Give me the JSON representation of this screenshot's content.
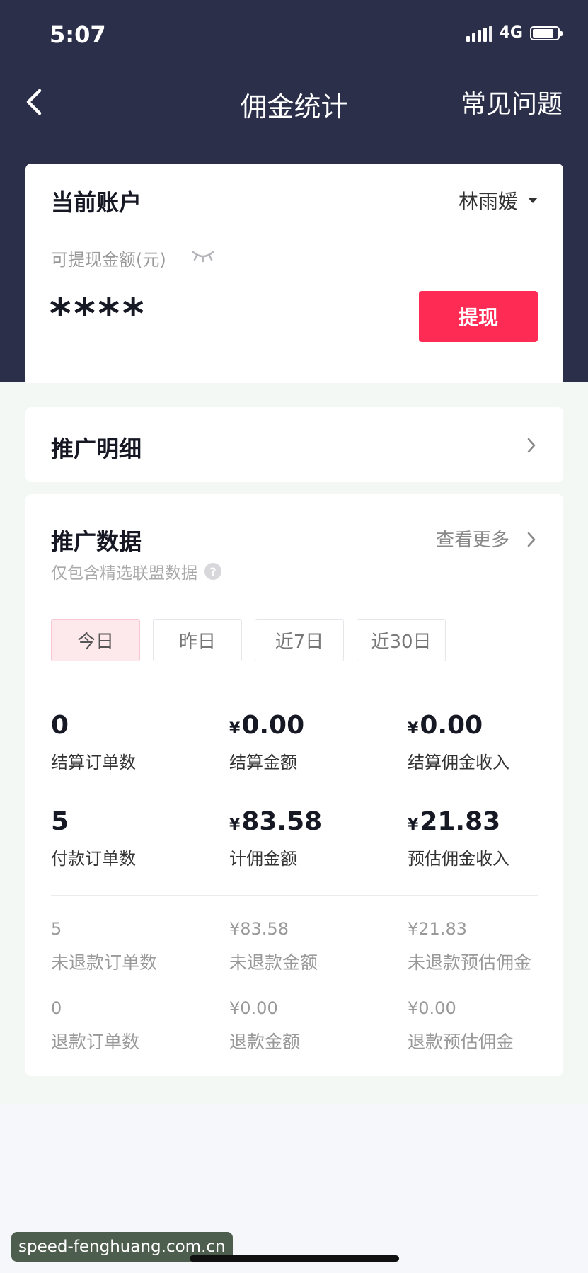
{
  "status_bar": {
    "time": "5:07",
    "network": "4G",
    "battery_level": 0.85,
    "signal_bars": 4
  },
  "nav": {
    "back_icon": "chevron-left-icon",
    "title": "佣金统计",
    "faq": "常见问题"
  },
  "account": {
    "title": "当前账户",
    "user": "林雨媛",
    "available_label": "可提现金额(元)",
    "amount_masked": "****",
    "withdraw_button": "提现"
  },
  "promo_detail": {
    "label": "推广明细"
  },
  "promo_data": {
    "title": "推广数据",
    "more": "查看更多",
    "subtitle": "仅包含精选联盟数据",
    "help_icon": "?",
    "tabs": [
      {
        "label": "今日",
        "active": true
      },
      {
        "label": "昨日",
        "active": false
      },
      {
        "label": "近7日",
        "active": false
      },
      {
        "label": "近30日",
        "active": false
      }
    ],
    "currency": "¥",
    "primary_stats": [
      {
        "value": "0",
        "label": "结算订单数"
      },
      {
        "value": "0.00",
        "label": "结算金额"
      },
      {
        "value": "0.00",
        "label": "结算佣金收入"
      },
      {
        "value": "5",
        "label": "付款订单数"
      },
      {
        "value": "83.58",
        "label": "计佣金额"
      },
      {
        "value": "21.83",
        "label": "预估佣金收入"
      }
    ],
    "secondary_stats": [
      {
        "value": "5",
        "label": "未退款订单数"
      },
      {
        "value": "¥83.58",
        "label": "未退款金额"
      },
      {
        "value": "¥21.83",
        "label": "未退款预估佣金"
      },
      {
        "value": "0",
        "label": "退款订单数"
      },
      {
        "value": "¥0.00",
        "label": "退款金额"
      },
      {
        "value": "¥0.00",
        "label": "退款预估佣金"
      }
    ]
  },
  "watermark": "speed-fenghuang.com.cn"
}
